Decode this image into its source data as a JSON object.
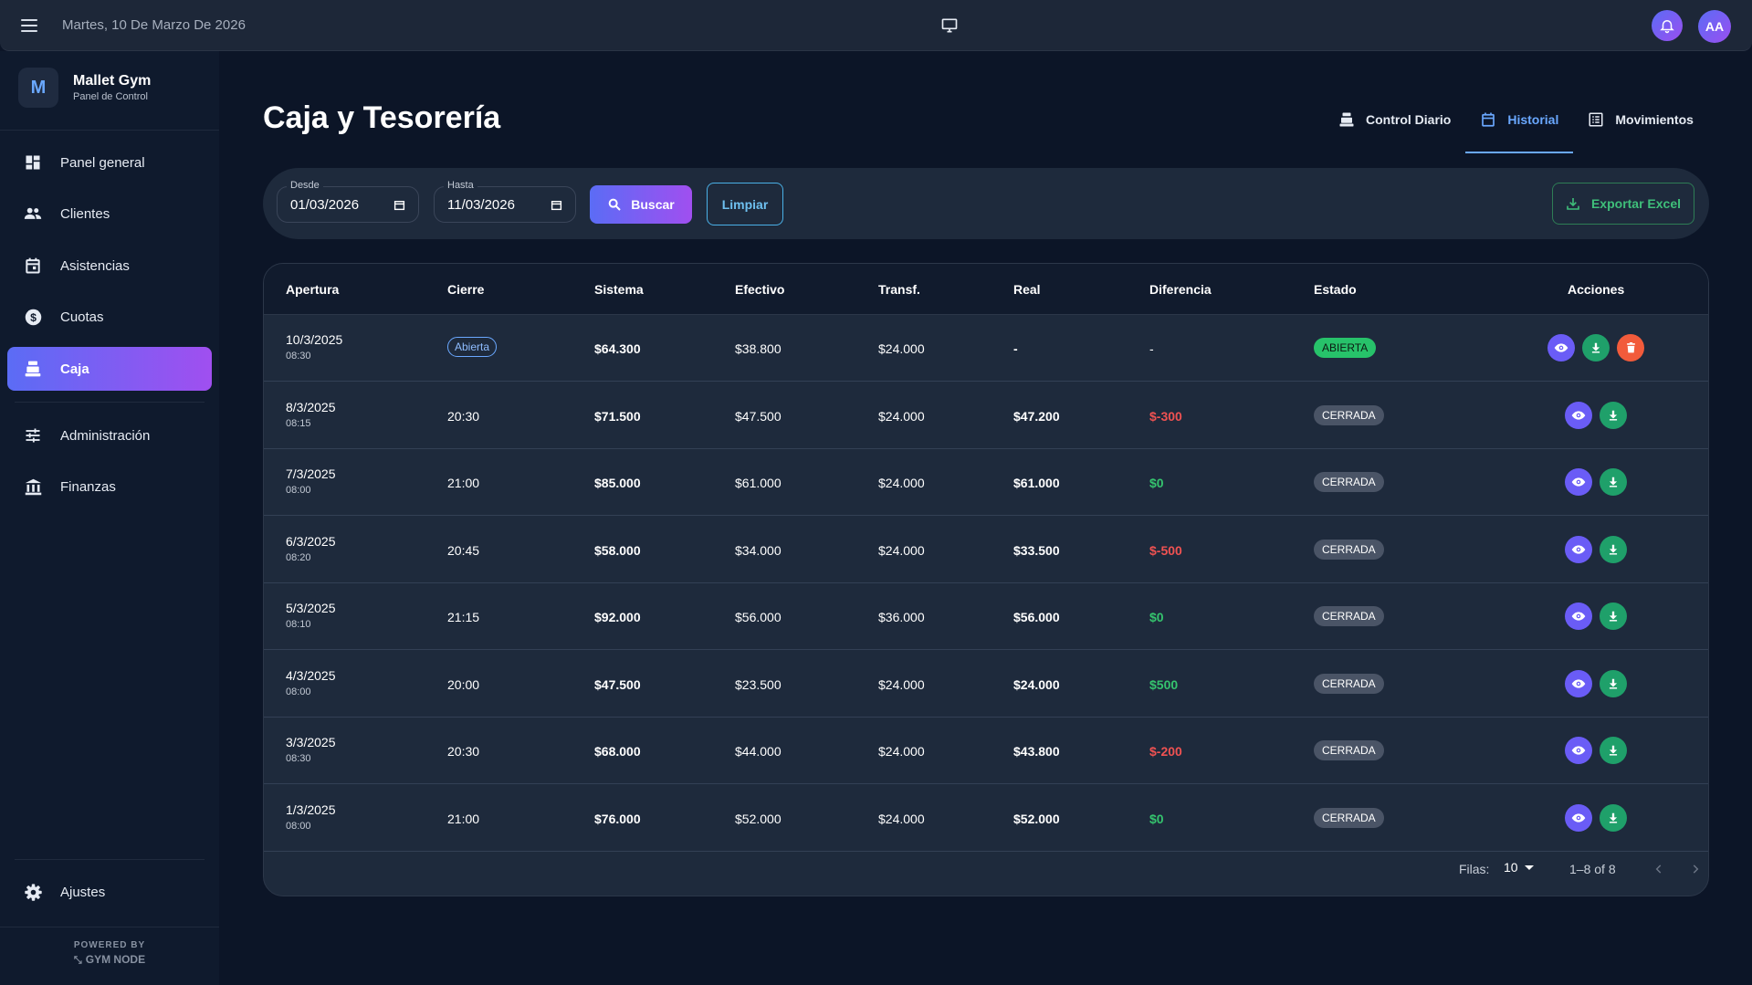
{
  "topbar": {
    "date": "Martes, 10 De Marzo De 2026",
    "avatar_initials": "AA",
    "icons": [
      "menu-icon",
      "monitor-icon",
      "bell-icon"
    ]
  },
  "brand": {
    "logo_letter": "M",
    "name": "Mallet Gym",
    "subtitle": "Panel de Control"
  },
  "sidebar": {
    "items": [
      {
        "label": "Panel general",
        "icon": "dashboard-icon"
      },
      {
        "label": "Clientes",
        "icon": "people-icon"
      },
      {
        "label": "Asistencias",
        "icon": "calendar-icon"
      },
      {
        "label": "Cuotas",
        "icon": "dollar-icon"
      },
      {
        "label": "Caja",
        "icon": "cash-register-icon",
        "active": true
      },
      {
        "label": "Administración",
        "icon": "sliders-icon"
      },
      {
        "label": "Finanzas",
        "icon": "bank-icon"
      }
    ],
    "settings_label": "Ajustes",
    "powered_by": "POWERED BY",
    "powered_name": "GYM NODE"
  },
  "page": {
    "title": "Caja y Tesorería",
    "tabs": [
      {
        "label": "Control Diario",
        "icon": "cash-register-icon"
      },
      {
        "label": "Historial",
        "icon": "calendar-icon",
        "active": true
      },
      {
        "label": "Movimientos",
        "icon": "list-icon"
      }
    ]
  },
  "filters": {
    "desde_label": "Desde",
    "desde_value": "01/03/2026",
    "hasta_label": "Hasta",
    "hasta_value": "11/03/2026",
    "buscar_label": "Buscar",
    "limpiar_label": "Limpiar",
    "export_label": "Exportar Excel"
  },
  "table": {
    "headers": [
      "Apertura",
      "Cierre",
      "Sistema",
      "Efectivo",
      "Transf.",
      "Real",
      "Diferencia",
      "Estado",
      "Acciones"
    ],
    "rows": [
      {
        "date": "10/3/2025",
        "time": "08:30",
        "cierre": "Abierta",
        "sistema": "$64.300",
        "efectivo": "$38.800",
        "transf": "$24.000",
        "real": "-",
        "diferencia": "-",
        "estado": "ABIERTA",
        "open": true
      },
      {
        "date": "8/3/2025",
        "time": "08:15",
        "cierre": "20:30",
        "sistema": "$71.500",
        "efectivo": "$47.500",
        "transf": "$24.000",
        "real": "$47.200",
        "diferencia": "$-300",
        "estado": "CERRADA"
      },
      {
        "date": "7/3/2025",
        "time": "08:00",
        "cierre": "21:00",
        "sistema": "$85.000",
        "efectivo": "$61.000",
        "transf": "$24.000",
        "real": "$61.000",
        "diferencia": "$0",
        "estado": "CERRADA"
      },
      {
        "date": "6/3/2025",
        "time": "08:20",
        "cierre": "20:45",
        "sistema": "$58.000",
        "efectivo": "$34.000",
        "transf": "$24.000",
        "real": "$33.500",
        "diferencia": "$-500",
        "estado": "CERRADA"
      },
      {
        "date": "5/3/2025",
        "time": "08:10",
        "cierre": "21:15",
        "sistema": "$92.000",
        "efectivo": "$56.000",
        "transf": "$36.000",
        "real": "$56.000",
        "diferencia": "$0",
        "estado": "CERRADA"
      },
      {
        "date": "4/3/2025",
        "time": "08:00",
        "cierre": "20:00",
        "sistema": "$47.500",
        "efectivo": "$23.500",
        "transf": "$24.000",
        "real": "$24.000",
        "diferencia": "$500",
        "estado": "CERRADA"
      },
      {
        "date": "3/3/2025",
        "time": "08:30",
        "cierre": "20:30",
        "sistema": "$68.000",
        "efectivo": "$44.000",
        "transf": "$24.000",
        "real": "$43.800",
        "diferencia": "$-200",
        "estado": "CERRADA"
      },
      {
        "date": "1/3/2025",
        "time": "08:00",
        "cierre": "21:00",
        "sistema": "$76.000",
        "efectivo": "$52.000",
        "transf": "$24.000",
        "real": "$52.000",
        "diferencia": "$0",
        "estado": "CERRADA"
      }
    ]
  },
  "pagination": {
    "rows_label": "Filas:",
    "rows_value": "10",
    "range": "1–8 of 8"
  },
  "colors": {
    "accent_start": "#5b6cf5",
    "accent_end": "#a04ff0",
    "negative": "#f05252",
    "positive": "#35c46e",
    "open_chip": "#27c26a"
  }
}
